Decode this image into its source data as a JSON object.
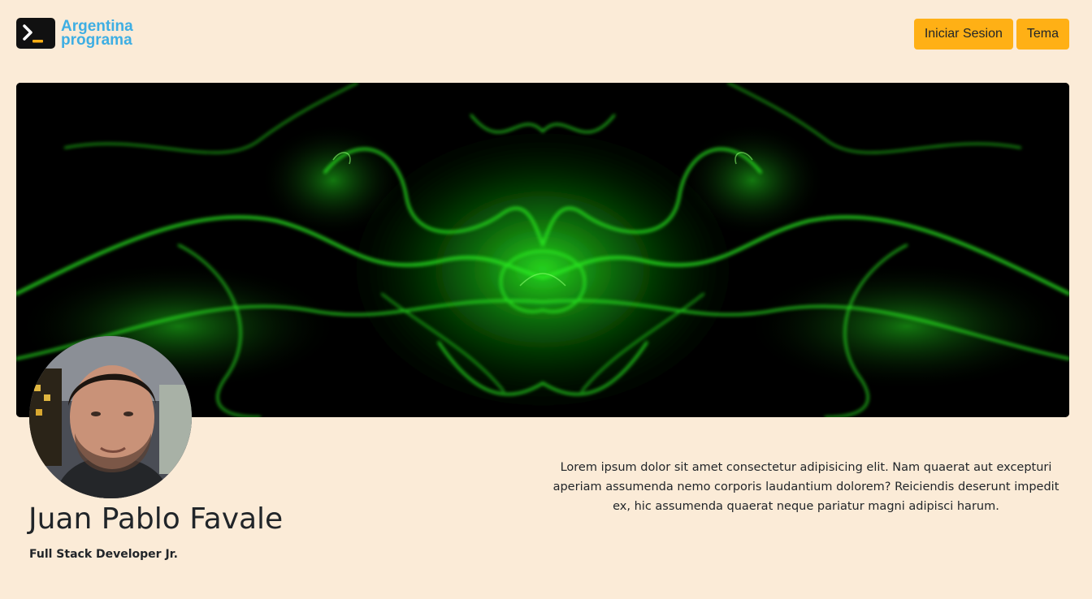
{
  "brand": {
    "line1": "Argentina",
    "line2": "programa",
    "color": "#3eaee3",
    "icon": "terminal-prompt-icon"
  },
  "nav": {
    "login_label": "Iniciar Sesion",
    "theme_label": "Tema",
    "button_color": "#ffb015"
  },
  "banner": {
    "description": "green-smoke-symmetric-image",
    "accent_color": "#1fd81a"
  },
  "profile": {
    "name": "Juan Pablo Favale",
    "role": "Full Stack Developer Jr.",
    "about": "Lorem ipsum dolor sit amet consectetur adipisicing elit. Nam quaerat aut excepturi aperiam assumenda nemo corporis laudantium dolorem? Reiciendis deserunt impedit ex, hic assumenda quaerat neque pariatur magni adipisci harum."
  },
  "theme": {
    "background": "#fbebd7",
    "text": "#212529"
  }
}
